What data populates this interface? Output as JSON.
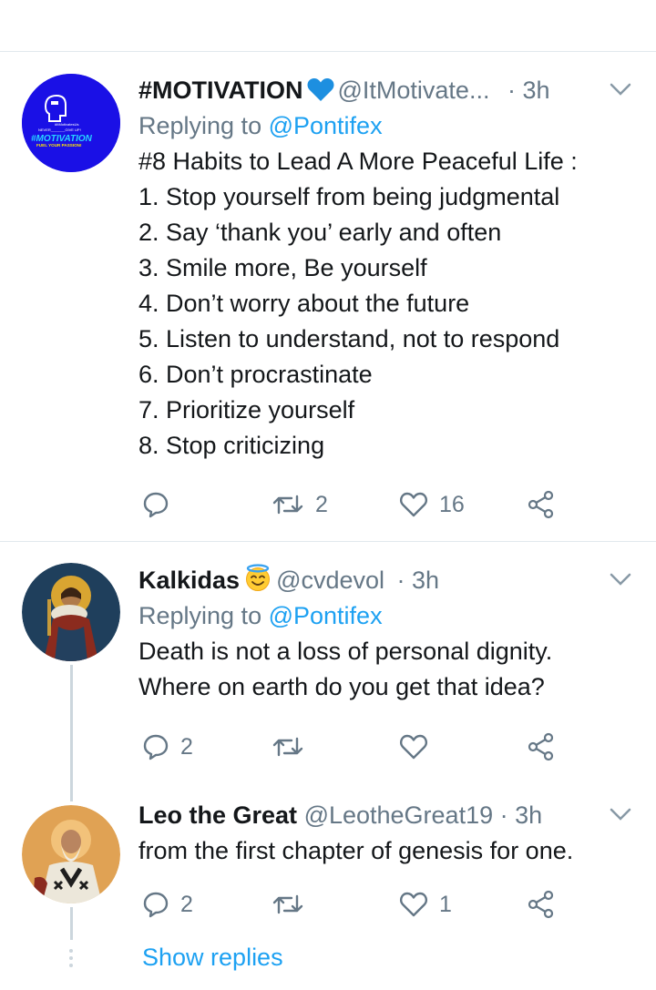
{
  "tweets": [
    {
      "display_name": "#MOTIVATION",
      "handle": "@ItMotivate...",
      "time": "· 3h",
      "replying_label": "Replying to",
      "replying_to": "@Pontifex",
      "text": "#8 Habits to Lead A More Peaceful Life :\n1. Stop yourself from being judgmental\n2. Say ‘thank you’ early and often\n3. Smile more, Be yourself\n4. Don’t worry about the future\n5. Listen to understand, not to respond\n6. Don’t procrastinate\n7. Prioritize yourself\n8. Stop criticizing",
      "retweet_count": "2",
      "like_count": "16",
      "avatar_lines": [
        "#ItMotivatesUs",
        "NEVER_______GIVE UP!",
        "#MOTIVATION",
        "FUEL YOUR PASSION!"
      ],
      "name_emoji": "blue-heart-icon"
    },
    {
      "display_name": "Kalkidas",
      "handle": "@cvdevol",
      "time": "· 3h",
      "replying_label": "Replying to",
      "replying_to": "@Pontifex",
      "text": "Death is not a loss of personal dignity.\nWhere on earth do you get that idea?",
      "reply_count": "2",
      "name_emoji": "smiling-face-with-halo-icon"
    },
    {
      "display_name": "Leo the Great",
      "handle": "@LeotheGreat19",
      "time": "· 3h",
      "text": "from the first chapter of genesis for one.",
      "reply_count": "2",
      "like_count": "1"
    }
  ],
  "show_replies": "Show replies",
  "colors": {
    "text": "#14171a",
    "secondary": "#657786",
    "link": "#1da1f2",
    "divider": "#e1e8ed",
    "heart_emoji": "#1d8fe0",
    "motivation_avatar_bg": "#1a10e6"
  }
}
